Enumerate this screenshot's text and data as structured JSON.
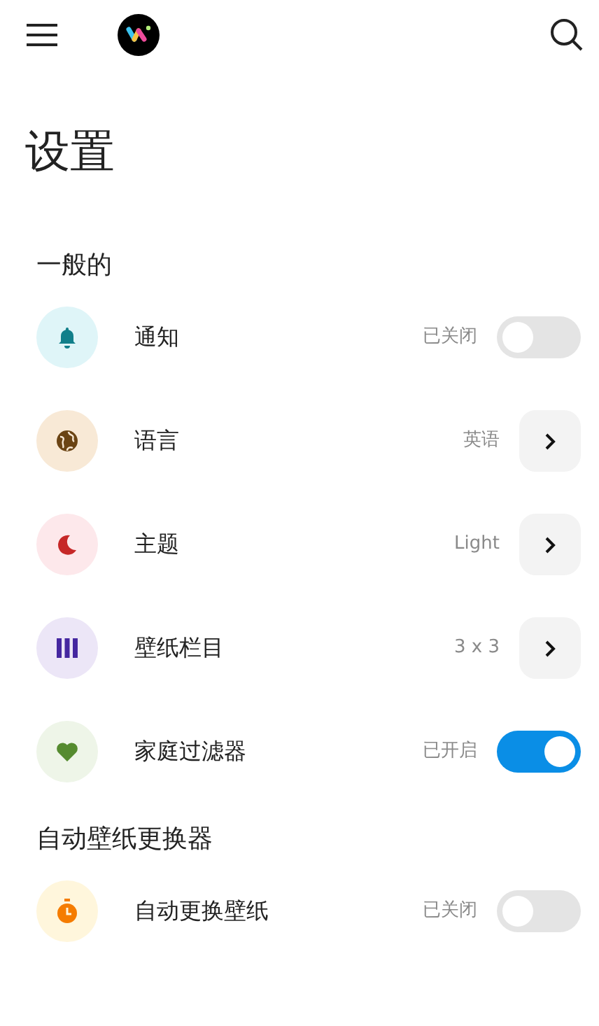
{
  "title": "设置",
  "sections": [
    {
      "heading": "一般的",
      "rows": [
        {
          "kind": "toggle",
          "label": "通知",
          "value": "已关闭",
          "on": false
        },
        {
          "kind": "link",
          "label": "语言",
          "value": "英语"
        },
        {
          "kind": "link",
          "label": "主题",
          "value": "Light"
        },
        {
          "kind": "link",
          "label": "壁纸栏目",
          "value": "3 x 3"
        },
        {
          "kind": "toggle",
          "label": "家庭过滤器",
          "value": "已开启",
          "on": true
        }
      ]
    },
    {
      "heading": "自动壁纸更换器",
      "rows": [
        {
          "kind": "toggle",
          "label": "自动更换壁纸",
          "value": "已关闭",
          "on": false
        }
      ]
    }
  ]
}
